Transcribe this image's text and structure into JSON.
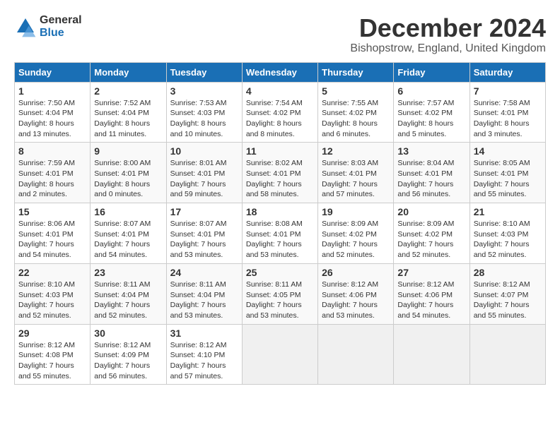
{
  "logo": {
    "line1": "General",
    "line2": "Blue"
  },
  "title": "December 2024",
  "subtitle": "Bishopstrow, England, United Kingdom",
  "weekdays": [
    "Sunday",
    "Monday",
    "Tuesday",
    "Wednesday",
    "Thursday",
    "Friday",
    "Saturday"
  ],
  "weeks": [
    [
      {
        "day": "1",
        "info": "Sunrise: 7:50 AM\nSunset: 4:04 PM\nDaylight: 8 hours\nand 13 minutes."
      },
      {
        "day": "2",
        "info": "Sunrise: 7:52 AM\nSunset: 4:04 PM\nDaylight: 8 hours\nand 11 minutes."
      },
      {
        "day": "3",
        "info": "Sunrise: 7:53 AM\nSunset: 4:03 PM\nDaylight: 8 hours\nand 10 minutes."
      },
      {
        "day": "4",
        "info": "Sunrise: 7:54 AM\nSunset: 4:02 PM\nDaylight: 8 hours\nand 8 minutes."
      },
      {
        "day": "5",
        "info": "Sunrise: 7:55 AM\nSunset: 4:02 PM\nDaylight: 8 hours\nand 6 minutes."
      },
      {
        "day": "6",
        "info": "Sunrise: 7:57 AM\nSunset: 4:02 PM\nDaylight: 8 hours\nand 5 minutes."
      },
      {
        "day": "7",
        "info": "Sunrise: 7:58 AM\nSunset: 4:01 PM\nDaylight: 8 hours\nand 3 minutes."
      }
    ],
    [
      {
        "day": "8",
        "info": "Sunrise: 7:59 AM\nSunset: 4:01 PM\nDaylight: 8 hours\nand 2 minutes."
      },
      {
        "day": "9",
        "info": "Sunrise: 8:00 AM\nSunset: 4:01 PM\nDaylight: 8 hours\nand 0 minutes."
      },
      {
        "day": "10",
        "info": "Sunrise: 8:01 AM\nSunset: 4:01 PM\nDaylight: 7 hours\nand 59 minutes."
      },
      {
        "day": "11",
        "info": "Sunrise: 8:02 AM\nSunset: 4:01 PM\nDaylight: 7 hours\nand 58 minutes."
      },
      {
        "day": "12",
        "info": "Sunrise: 8:03 AM\nSunset: 4:01 PM\nDaylight: 7 hours\nand 57 minutes."
      },
      {
        "day": "13",
        "info": "Sunrise: 8:04 AM\nSunset: 4:01 PM\nDaylight: 7 hours\nand 56 minutes."
      },
      {
        "day": "14",
        "info": "Sunrise: 8:05 AM\nSunset: 4:01 PM\nDaylight: 7 hours\nand 55 minutes."
      }
    ],
    [
      {
        "day": "15",
        "info": "Sunrise: 8:06 AM\nSunset: 4:01 PM\nDaylight: 7 hours\nand 54 minutes."
      },
      {
        "day": "16",
        "info": "Sunrise: 8:07 AM\nSunset: 4:01 PM\nDaylight: 7 hours\nand 54 minutes."
      },
      {
        "day": "17",
        "info": "Sunrise: 8:07 AM\nSunset: 4:01 PM\nDaylight: 7 hours\nand 53 minutes."
      },
      {
        "day": "18",
        "info": "Sunrise: 8:08 AM\nSunset: 4:01 PM\nDaylight: 7 hours\nand 53 minutes."
      },
      {
        "day": "19",
        "info": "Sunrise: 8:09 AM\nSunset: 4:02 PM\nDaylight: 7 hours\nand 52 minutes."
      },
      {
        "day": "20",
        "info": "Sunrise: 8:09 AM\nSunset: 4:02 PM\nDaylight: 7 hours\nand 52 minutes."
      },
      {
        "day": "21",
        "info": "Sunrise: 8:10 AM\nSunset: 4:03 PM\nDaylight: 7 hours\nand 52 minutes."
      }
    ],
    [
      {
        "day": "22",
        "info": "Sunrise: 8:10 AM\nSunset: 4:03 PM\nDaylight: 7 hours\nand 52 minutes."
      },
      {
        "day": "23",
        "info": "Sunrise: 8:11 AM\nSunset: 4:04 PM\nDaylight: 7 hours\nand 52 minutes."
      },
      {
        "day": "24",
        "info": "Sunrise: 8:11 AM\nSunset: 4:04 PM\nDaylight: 7 hours\nand 53 minutes."
      },
      {
        "day": "25",
        "info": "Sunrise: 8:11 AM\nSunset: 4:05 PM\nDaylight: 7 hours\nand 53 minutes."
      },
      {
        "day": "26",
        "info": "Sunrise: 8:12 AM\nSunset: 4:06 PM\nDaylight: 7 hours\nand 53 minutes."
      },
      {
        "day": "27",
        "info": "Sunrise: 8:12 AM\nSunset: 4:06 PM\nDaylight: 7 hours\nand 54 minutes."
      },
      {
        "day": "28",
        "info": "Sunrise: 8:12 AM\nSunset: 4:07 PM\nDaylight: 7 hours\nand 55 minutes."
      }
    ],
    [
      {
        "day": "29",
        "info": "Sunrise: 8:12 AM\nSunset: 4:08 PM\nDaylight: 7 hours\nand 55 minutes."
      },
      {
        "day": "30",
        "info": "Sunrise: 8:12 AM\nSunset: 4:09 PM\nDaylight: 7 hours\nand 56 minutes."
      },
      {
        "day": "31",
        "info": "Sunrise: 8:12 AM\nSunset: 4:10 PM\nDaylight: 7 hours\nand 57 minutes."
      },
      null,
      null,
      null,
      null
    ]
  ]
}
